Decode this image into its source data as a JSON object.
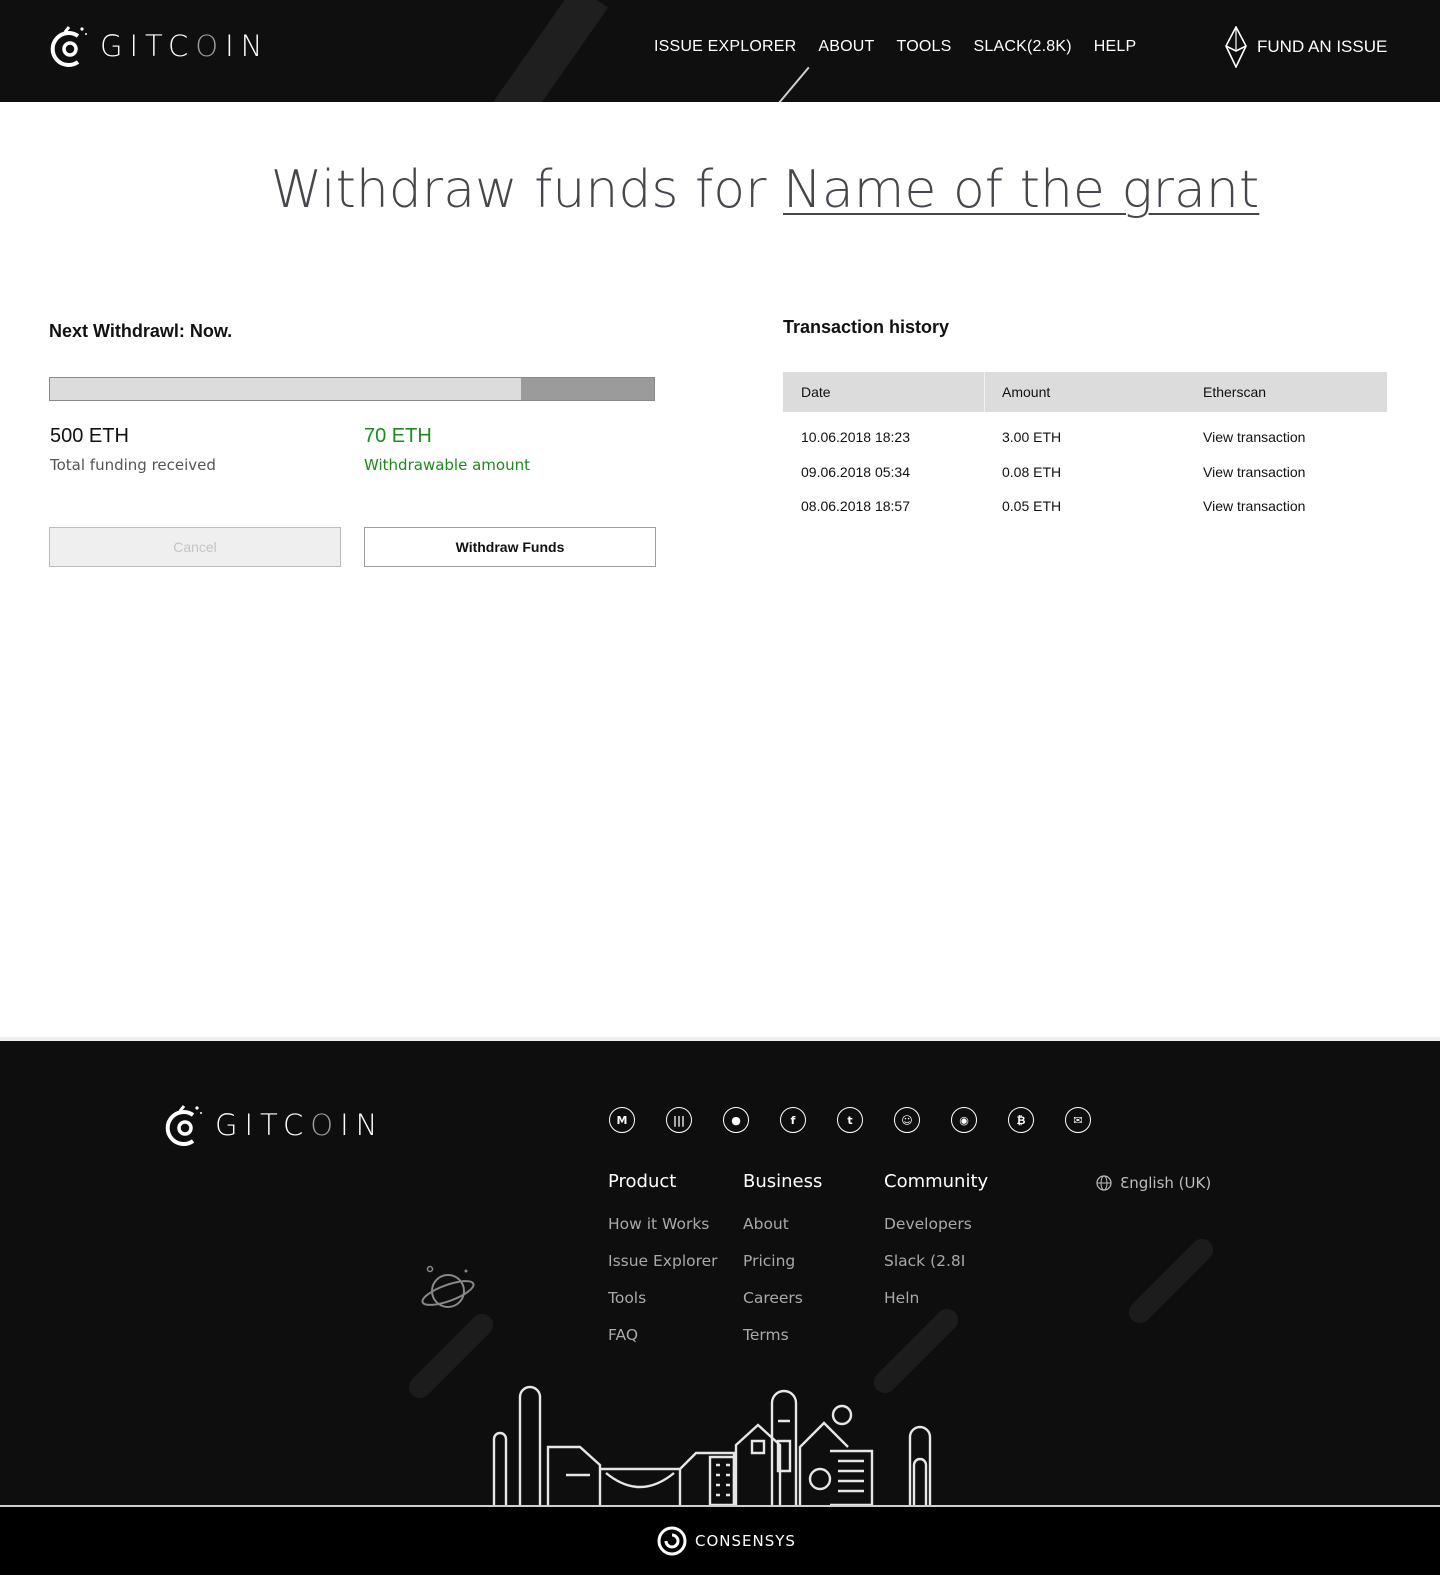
{
  "header": {
    "logo_text": "GITCOIN",
    "nav": [
      {
        "label": "ISSUE EXPLORER"
      },
      {
        "label": "ABOUT"
      },
      {
        "label": "TOOLS"
      },
      {
        "label": "SLACK(2.8K)"
      },
      {
        "label": "HELP"
      }
    ],
    "fund_label": "FUND AN ISSUE",
    "fund_icon": "ethereum-icon"
  },
  "page": {
    "title_prefix": "Withdraw funds for",
    "title_grant": "Name of the grant"
  },
  "withdraw": {
    "next_label": "Next Withdrawl: Now.",
    "withdrawable_fraction": 0.221,
    "total_value": "500 ETH",
    "total_label": "Total funding received",
    "withdrawable_value": "70 ETH",
    "withdrawable_label": "Withdrawable amount",
    "cancel_label": "Cancel",
    "withdraw_label": "Withdraw Funds",
    "colors": {
      "withdrawable": "#1d8a1d",
      "bar_fill": "#9b9b9b",
      "bar_bg": "#dcdcdc"
    }
  },
  "transactions": {
    "title": "Transaction history",
    "columns": [
      "Date",
      "Amount",
      "Etherscan"
    ],
    "rows": [
      {
        "date": "10.06.2018  18:23",
        "amount": "3.00 ETH",
        "link": "View transaction"
      },
      {
        "date": "09.06.2018  05:34",
        "amount": "0.08 ETH",
        "link": "View transaction"
      },
      {
        "date": "08.06.2018  18:57",
        "amount": "0.05 ETH",
        "link": "View transaction"
      }
    ]
  },
  "footer": {
    "logo_text": "GITCOIN",
    "socials": [
      {
        "icon": "medium-icon",
        "glyph": "M"
      },
      {
        "icon": "gitter-icon",
        "glyph": "|||"
      },
      {
        "icon": "github-icon",
        "glyph": "●"
      },
      {
        "icon": "facebook-icon",
        "glyph": "f"
      },
      {
        "icon": "twitter-icon",
        "glyph": "t"
      },
      {
        "icon": "reddit-icon",
        "glyph": "☺"
      },
      {
        "icon": "discord-icon",
        "glyph": "◉"
      },
      {
        "icon": "bitcoin-icon",
        "glyph": "₿"
      },
      {
        "icon": "email-icon",
        "glyph": "✉"
      }
    ],
    "columns": [
      {
        "heading": "Product",
        "links": [
          "How it Works",
          "Issue Explorer",
          "Tools",
          "FAQ"
        ]
      },
      {
        "heading": "Business",
        "links": [
          "About",
          "Pricing",
          "Careers",
          "Terms"
        ]
      },
      {
        "heading": "Community",
        "links": [
          "Developers",
          "Slack (2.8I",
          "Heln"
        ]
      }
    ],
    "language": "Ɛnglish (UK)",
    "language_icon": "globe-icon",
    "brand": "CONSENSYS"
  }
}
